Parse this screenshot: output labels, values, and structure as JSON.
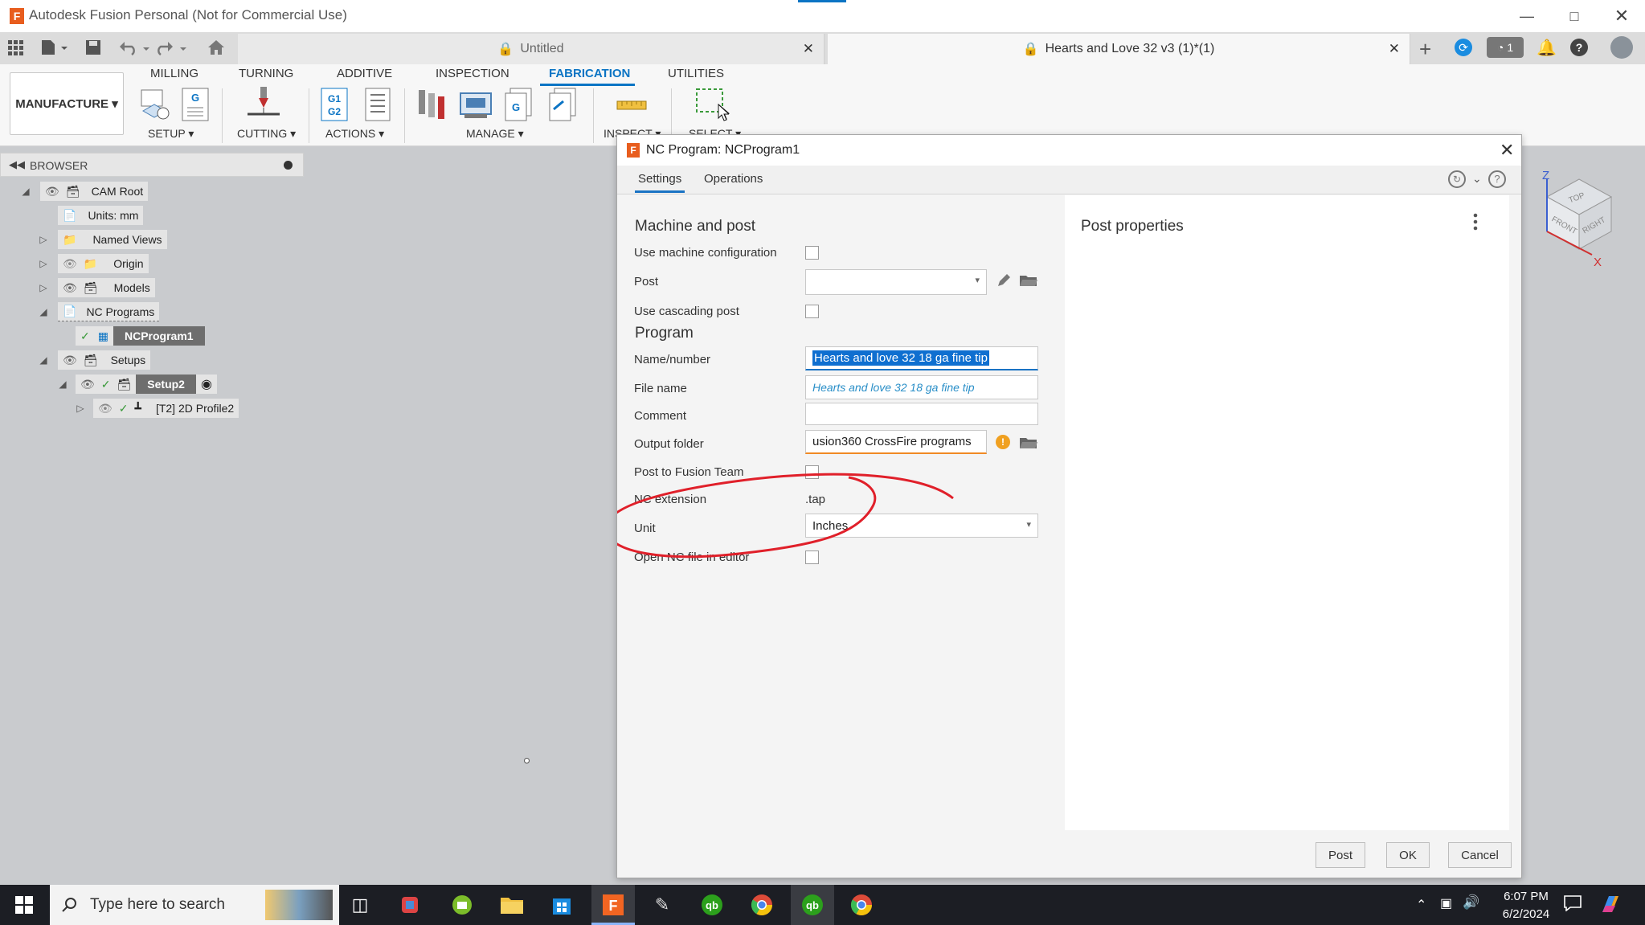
{
  "app": {
    "title": "Autodesk Fusion Personal (Not for Commercial Use)"
  },
  "tabs": [
    {
      "label": "Untitled"
    },
    {
      "label": "Hearts and Love 32 v3 (1)*(1)"
    }
  ],
  "toolbar": {
    "notifications_count": "1"
  },
  "ribbon": {
    "workspace": "MANUFACTURE",
    "tabs": [
      "MILLING",
      "TURNING",
      "ADDITIVE",
      "INSPECTION",
      "FABRICATION",
      "UTILITIES"
    ],
    "active_tab": "FABRICATION",
    "groups": [
      "SETUP",
      "CUTTING",
      "ACTIONS",
      "MANAGE",
      "INSPECT",
      "SELECT"
    ]
  },
  "browser": {
    "title": "BROWSER",
    "nodes": {
      "cam_root": "CAM Root",
      "units": "Units: mm",
      "named_views": "Named Views",
      "origin": "Origin",
      "models": "Models",
      "nc_programs": "NC Programs",
      "ncprogram1": "NCProgram1",
      "setups": "Setups",
      "setup2": "Setup2",
      "profile": "[T2] 2D Profile2"
    }
  },
  "dialog": {
    "title": "NC Program: NCProgram1",
    "tabs": [
      "Settings",
      "Operations"
    ],
    "machine_section": "Machine and post",
    "use_machine_configuration": {
      "label": "Use machine configuration",
      "checked": false
    },
    "post": {
      "label": "Post",
      "value": ""
    },
    "use_cascading_post": {
      "label": "Use cascading post",
      "checked": false
    },
    "program_section": "Program",
    "name_number": {
      "label": "Name/number",
      "value": "Hearts and love 32 18 ga fine tip"
    },
    "file_name": {
      "label": "File name",
      "value": "Hearts and love 32 18 ga fine tip"
    },
    "comment": {
      "label": "Comment",
      "value": ""
    },
    "output_folder": {
      "label": "Output folder",
      "value": "usion360 CrossFire programs"
    },
    "post_to_fusion_team": {
      "label": "Post to Fusion Team",
      "checked": false
    },
    "nc_extension": {
      "label": "NC extension",
      "value": ".tap"
    },
    "unit": {
      "label": "Unit",
      "value": "Inches"
    },
    "open_nc_file": {
      "label": "Open NC file in editor",
      "checked": false
    },
    "post_properties": "Post properties",
    "buttons": {
      "post": "Post",
      "ok": "OK",
      "cancel": "Cancel"
    }
  },
  "viewcube": {
    "top": "TOP",
    "front": "FRONT",
    "right": "RIGHT",
    "z": "Z",
    "x": "X"
  },
  "taskbar": {
    "search_placeholder": "Type here to search",
    "time": "6:07 PM",
    "date": "6/2/2024"
  },
  "colors": {
    "accent": "#0b74c4",
    "annotation": "#e0202a",
    "orange": "#f26522",
    "selection": "#0f6fd0"
  }
}
